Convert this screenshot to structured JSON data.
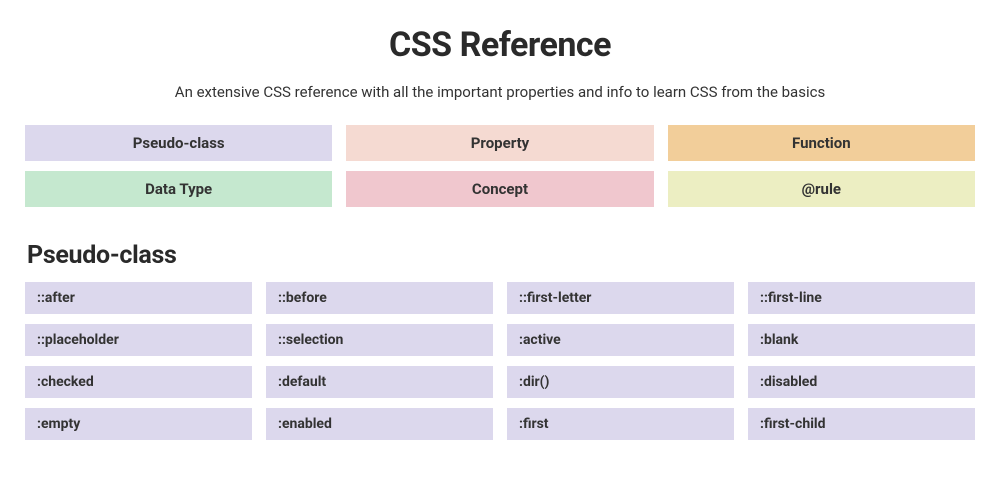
{
  "header": {
    "title": "CSS Reference",
    "subtitle": "An extensive CSS reference with all the important properties and info to learn CSS from the basics"
  },
  "categories": [
    {
      "label": "Pseudo-class",
      "class": "cat-pseudo"
    },
    {
      "label": "Property",
      "class": "cat-property"
    },
    {
      "label": "Function",
      "class": "cat-function"
    },
    {
      "label": "Data Type",
      "class": "cat-datatype"
    },
    {
      "label": "Concept",
      "class": "cat-concept"
    },
    {
      "label": "@rule",
      "class": "cat-rule"
    }
  ],
  "section": {
    "title": "Pseudo-class",
    "items": [
      "::after",
      "::before",
      "::first-letter",
      "::first-line",
      "::placeholder",
      "::selection",
      ":active",
      ":blank",
      ":checked",
      ":default",
      ":dir()",
      ":disabled",
      ":empty",
      ":enabled",
      ":first",
      ":first-child"
    ]
  }
}
